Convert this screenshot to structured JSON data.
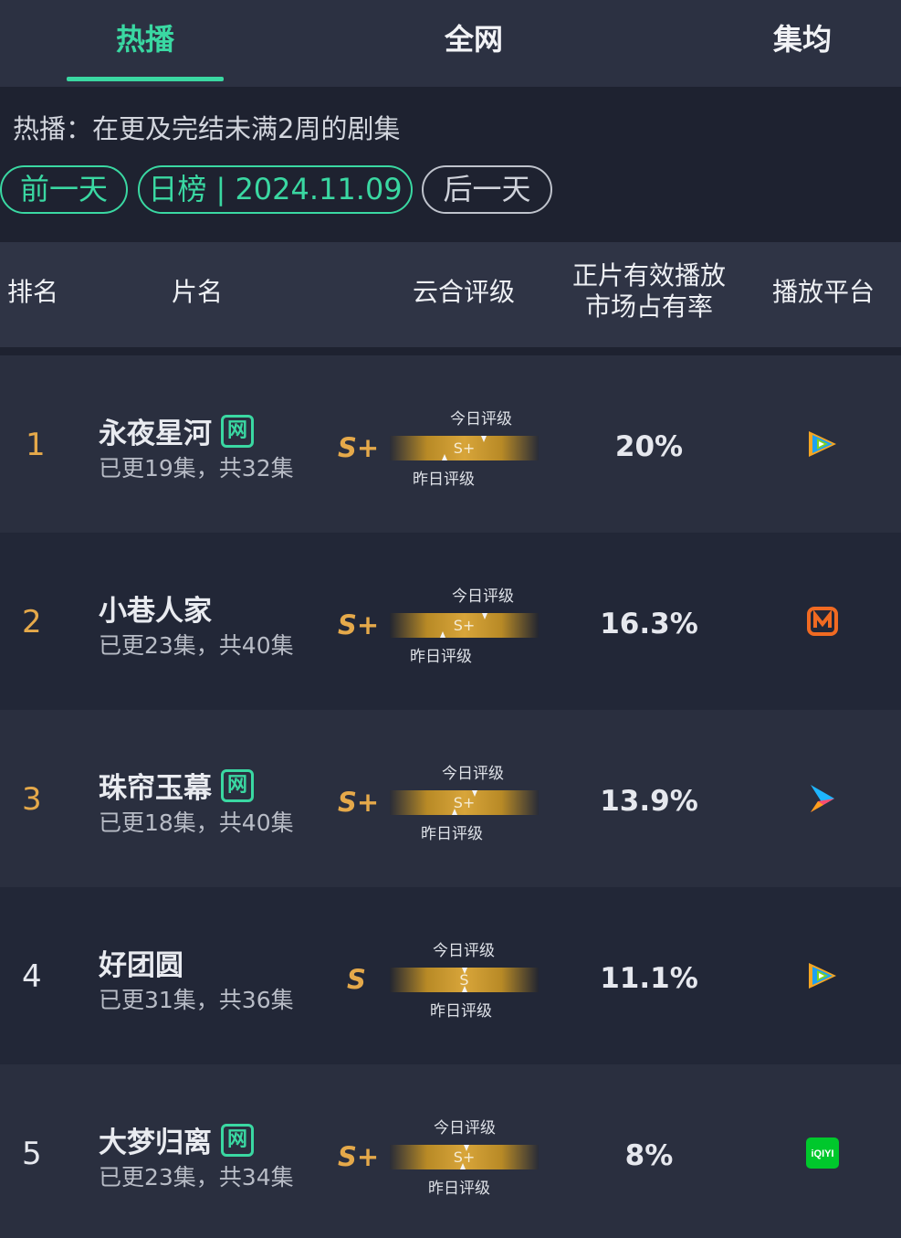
{
  "tabs": [
    {
      "label": "热播",
      "active": true
    },
    {
      "label": "全网",
      "active": false
    },
    {
      "label": "集均",
      "active": false
    }
  ],
  "description": "热播：在更及完结未满2周的剧集",
  "nav": {
    "prev": "前一天",
    "current": "日榜 | 2024.11.09",
    "next": "后一天"
  },
  "headers": {
    "rank": "排名",
    "title": "片名",
    "rating": "云合评级",
    "share_line1": "正片有效播放",
    "share_line2": "市场占有率",
    "platform": "播放平台"
  },
  "labels": {
    "today": "今日评级",
    "yesterday": "昨日评级",
    "net_badge": "网"
  },
  "rows": [
    {
      "rank": "1",
      "title": "永夜星河",
      "net": true,
      "episodes": "已更19集，共32集",
      "grade": "S+",
      "bar_grade": "S+",
      "share": "20%",
      "platform": "tencent-video-icon",
      "rank_color": "#e5a94a"
    },
    {
      "rank": "2",
      "title": "小巷人家",
      "net": false,
      "episodes": "已更23集，共40集",
      "grade": "S+",
      "bar_grade": "S+",
      "share": "16.3%",
      "platform": "mango-tv-icon",
      "rank_color": "#e5a94a"
    },
    {
      "rank": "3",
      "title": "珠帘玉幕",
      "net": true,
      "episodes": "已更18集，共40集",
      "grade": "S+",
      "bar_grade": "S+",
      "share": "13.9%",
      "platform": "youku-icon",
      "rank_color": "#e5a94a"
    },
    {
      "rank": "4",
      "title": "好团圆",
      "net": false,
      "episodes": "已更31集，共36集",
      "grade": "S",
      "bar_grade": "S",
      "share": "11.1%",
      "platform": "tencent-video-icon",
      "rank_color": "#e6e8ee"
    },
    {
      "rank": "5",
      "title": "大梦归离",
      "net": true,
      "episodes": "已更23集，共34集",
      "grade": "S+",
      "bar_grade": "S+",
      "share": "8%",
      "platform": "iqiyi-icon",
      "platform_text": "iQIYI",
      "rank_color": "#e6e8ee"
    }
  ],
  "colors": {
    "accent": "#3ad8a2",
    "grade": "#e5a94a",
    "background": "#1e2230"
  }
}
